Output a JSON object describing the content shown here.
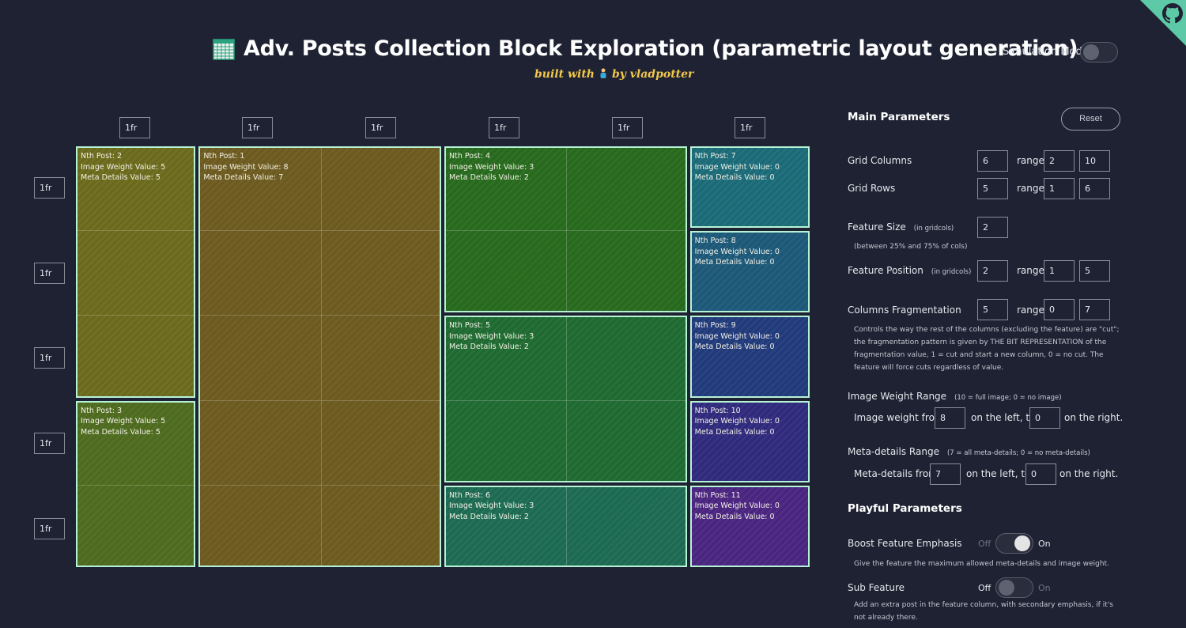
{
  "header": {
    "title": "Adv. Posts Collection Block Exploration (parametric layout generation)",
    "built_prefix": "built with",
    "built_suffix": "by vladpotter",
    "sim_label": "Simulation Mode",
    "sim_on": false
  },
  "columns": [
    "1fr",
    "1fr",
    "1fr",
    "1fr",
    "1fr",
    "1fr"
  ],
  "rows": [
    "1fr",
    "1fr",
    "1fr",
    "1fr",
    "1fr"
  ],
  "posts": [
    {
      "nth": "Nth Post: 2",
      "img": "Image Weight Value: 5",
      "meta": "Meta Details Value: 5",
      "color": "#6b6a1c"
    },
    {
      "nth": "Nth Post: 1",
      "img": "Image Weight Value: 8",
      "meta": "Meta Details Value: 7",
      "color": "#6c5a1f"
    },
    {
      "nth": "Nth Post: 4",
      "img": "Image Weight Value: 3",
      "meta": "Meta Details Value: 2",
      "color": "#27691d"
    },
    {
      "nth": "Nth Post: 7",
      "img": "Image Weight Value: 0",
      "meta": "Meta Details Value: 0",
      "color": "#1b6a78"
    },
    {
      "nth": "Nth Post: 8",
      "img": "Image Weight Value: 0",
      "meta": "Meta Details Value: 0",
      "color": "#1c5878"
    },
    {
      "nth": "Nth Post: 5",
      "img": "Image Weight Value: 3",
      "meta": "Meta Details Value: 2",
      "color": "#1f6a31"
    },
    {
      "nth": "Nth Post: 9",
      "img": "Image Weight Value: 0",
      "meta": "Meta Details Value: 0",
      "color": "#213a7a"
    },
    {
      "nth": "Nth Post: 3",
      "img": "Image Weight Value: 5",
      "meta": "Meta Details Value: 5",
      "color": "#4d6a1e"
    },
    {
      "nth": "Nth Post: 10",
      "img": "Image Weight Value: 0",
      "meta": "Meta Details Value: 0",
      "color": "#2f2a7c"
    },
    {
      "nth": "Nth Post: 6",
      "img": "Image Weight Value: 3",
      "meta": "Meta Details Value: 2",
      "color": "#1d6a52"
    },
    {
      "nth": "Nth Post: 11",
      "img": "Image Weight Value: 0",
      "meta": "Meta Details Value: 0",
      "color": "#4a2580"
    }
  ],
  "panel": {
    "main_title": "Main Parameters",
    "reset": "Reset",
    "range": "range",
    "grid_columns": {
      "label": "Grid Columns",
      "value": "6",
      "min": "2",
      "max": "10"
    },
    "grid_rows": {
      "label": "Grid Rows",
      "value": "5",
      "min": "1",
      "max": "6"
    },
    "feature_size": {
      "label": "Feature Size",
      "unit": "(in gridcols)",
      "value": "2",
      "note": "(between 25% and 75% of cols)"
    },
    "feature_position": {
      "label": "Feature Position",
      "unit": "(in gridcols)",
      "value": "2",
      "min": "1",
      "max": "5"
    },
    "fragmentation": {
      "label": "Columns Fragmentation",
      "value": "5",
      "min": "0",
      "max": "7",
      "note": "Controls the way the rest of the columns (excluding the feature) are \"cut\"; the fragmentation pattern is given by THE BIT REPRESENTATION of the fragmentation value, 1 = cut and start a new column, 0 = no cut. The feature will force cuts regardless of value."
    },
    "image_weight": {
      "label": "Image Weight Range",
      "hint": "(10 = full image; 0 = no image)",
      "from_label": "Image weight from",
      "from": "8",
      "mid": "on the left, to",
      "to": "0",
      "end": "on the right."
    },
    "meta_details": {
      "label": "Meta-details Range",
      "hint": "(7 = all meta-details; 0 = no meta-details)",
      "from_label": "Meta-details from",
      "from": "7",
      "mid": "on the left, to",
      "to": "0",
      "end": "on the right."
    },
    "playful_title": "Playful Parameters",
    "boost": {
      "label": "Boost Feature Emphasis",
      "off": "Off",
      "on": "On",
      "state": true,
      "note": "Give the feature the maximum allowed meta-details and image weight."
    },
    "sub_feature": {
      "label": "Sub Feature",
      "off": "Off",
      "on": "On",
      "state": false,
      "note": "Add an extra post in the feature column, with secondary emphasis, if it's not already there."
    }
  }
}
